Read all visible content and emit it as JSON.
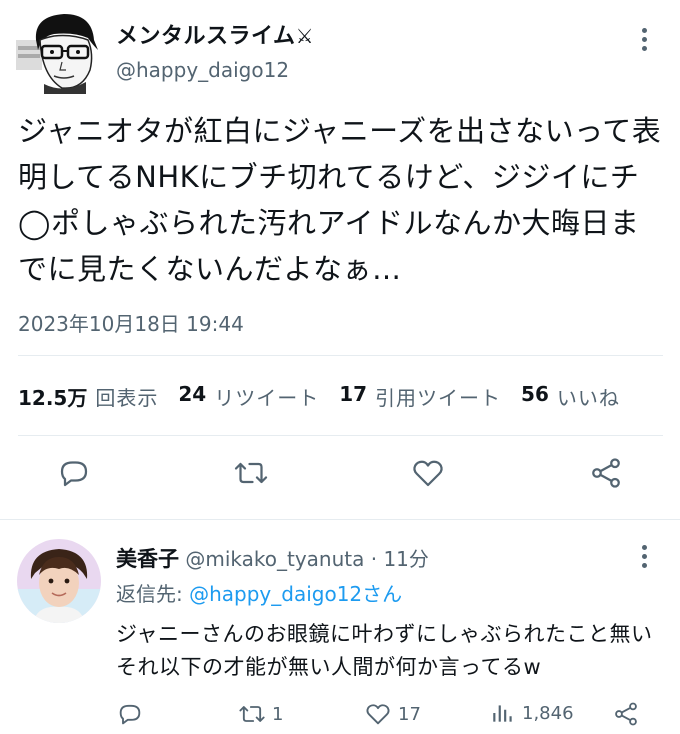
{
  "main_tweet": {
    "display_name": "メンタルスライム",
    "handle": "@happy_daigo12",
    "text": "ジャニオタが紅白にジャニーズを出さないって表明してるNHKにブチ切れてるけど、ジジイにチ◯ポしゃぶられた汚れアイドルなんか大晦日までに見たくないんだよなぁ…",
    "timestamp": "2023年10月18日 19:44",
    "stats": {
      "views_count": "12.5万",
      "views_label": "回表示",
      "retweets_count": "24",
      "retweets_label": "リツイート",
      "quotes_count": "17",
      "quotes_label": "引用ツイート",
      "likes_count": "56",
      "likes_label": "いいね"
    },
    "actions": [
      "reply-icon",
      "retweet-icon",
      "like-icon",
      "share-icon"
    ]
  },
  "reply": {
    "display_name": "美香子",
    "meta": " @mikako_tyanuta · 11分",
    "reply_to_prefix": "返信先: ",
    "reply_to_mention": "@happy_daigo12さん",
    "text": "ジャニーさんのお眼鏡に叶わずにしゃぶられたこと無いそれ以下の才能が無い人間が何か言ってるw",
    "retweet_count": "1",
    "like_count": "17",
    "view_count": "1,846"
  },
  "colors": {
    "text_primary": "#0f1419",
    "text_secondary": "#536471",
    "accent": "#1d9bf0",
    "divider": "#e6ecf0"
  }
}
